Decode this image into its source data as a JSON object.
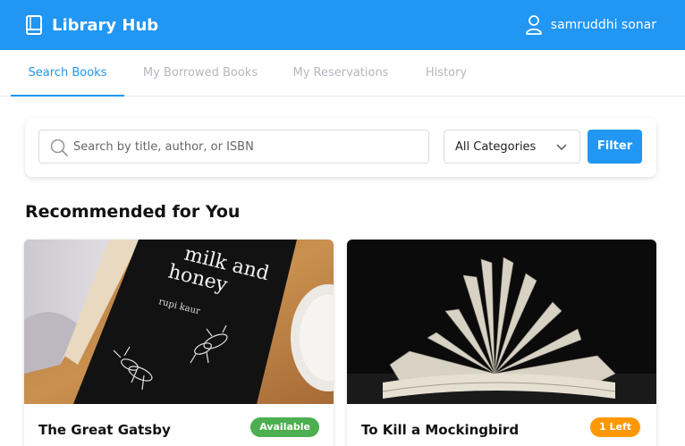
{
  "app": {
    "title": "Library Hub",
    "brand_color": "#2196f3"
  },
  "header": {
    "user_name": "samruddhi sonar"
  },
  "tabs": [
    {
      "label": "Search Books",
      "active": true
    },
    {
      "label": "My Borrowed Books",
      "active": false
    },
    {
      "label": "My Reservations",
      "active": false
    },
    {
      "label": "History",
      "active": false
    }
  ],
  "search": {
    "placeholder": "Search by title, author, or ISBN",
    "value": "",
    "category_selected": "All Categories",
    "filter_label": "Filter"
  },
  "recommended": {
    "title": "Recommended for You",
    "books": [
      {
        "title": "The Great Gatsby",
        "status": "Available",
        "status_color": "#4caf50",
        "cover_text": {
          "line1": "milk and",
          "line2": "honey",
          "author": "rupi kaur"
        }
      },
      {
        "title": "To Kill a Mockingbird",
        "status": "1 Left",
        "status_color": "#ff9800"
      }
    ]
  }
}
